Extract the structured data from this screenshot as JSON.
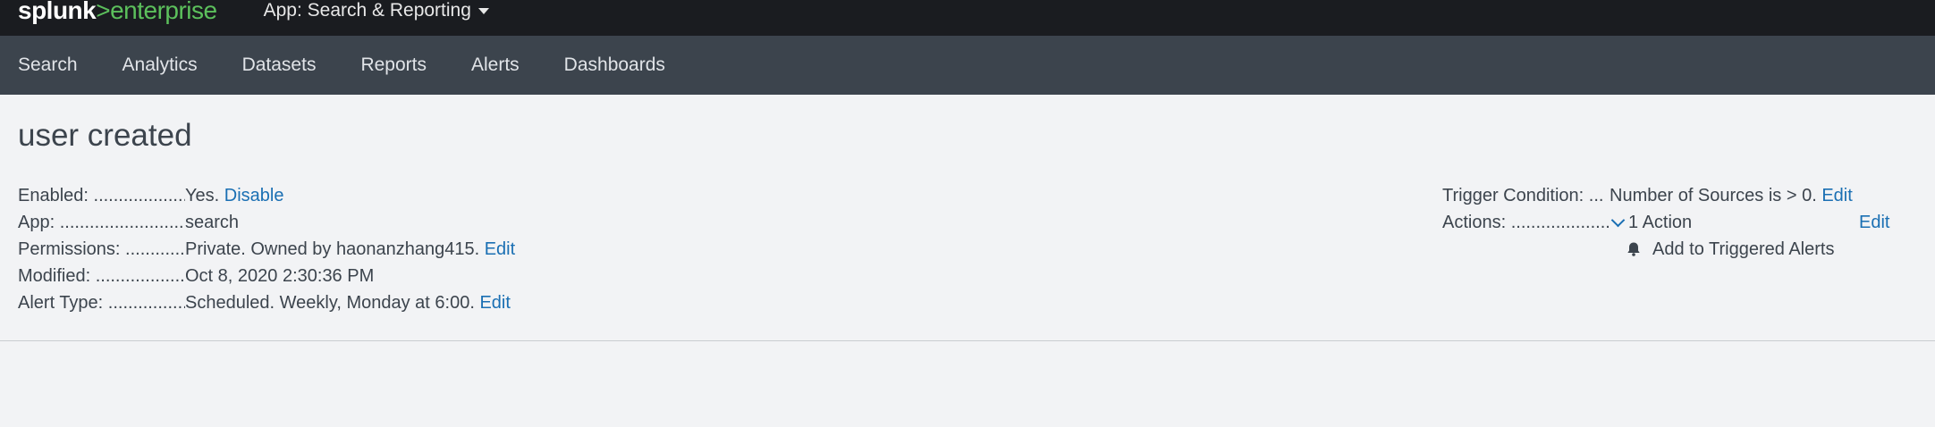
{
  "header": {
    "logo_left": "splunk",
    "logo_gt": ">",
    "logo_right": "enterprise",
    "app_menu": "App: Search & Reporting"
  },
  "nav": {
    "items": [
      "Search",
      "Analytics",
      "Datasets",
      "Reports",
      "Alerts",
      "Dashboards"
    ]
  },
  "alert": {
    "title": "user created",
    "details": [
      {
        "label": "Enabled: ....................",
        "value": "Yes.",
        "link": "Disable"
      },
      {
        "label": "App: .............................",
        "value": "search",
        "link": ""
      },
      {
        "label": "Permissions: ............",
        "value": "Private. Owned by haonanzhang415.",
        "link": "Edit"
      },
      {
        "label": "Modified: ..................",
        "value": "Oct 8, 2020 2:30:36 PM",
        "link": ""
      },
      {
        "label": "Alert Type: ................",
        "value": "Scheduled. Weekly, Monday at 6:00.",
        "link": "Edit"
      }
    ],
    "trigger_label": "Trigger Condition: ...",
    "trigger_value": "Number of Sources is > 0.",
    "trigger_link": "Edit",
    "actions_label": "Actions: .....................",
    "actions_value": "1 Action",
    "actions_link": "Edit",
    "action_item": "Add to Triggered Alerts"
  },
  "colors": {
    "topbar": "#1a1c20",
    "navbar": "#3c444d",
    "link": "#1a6fb3",
    "brand_green": "#5cc05c"
  }
}
